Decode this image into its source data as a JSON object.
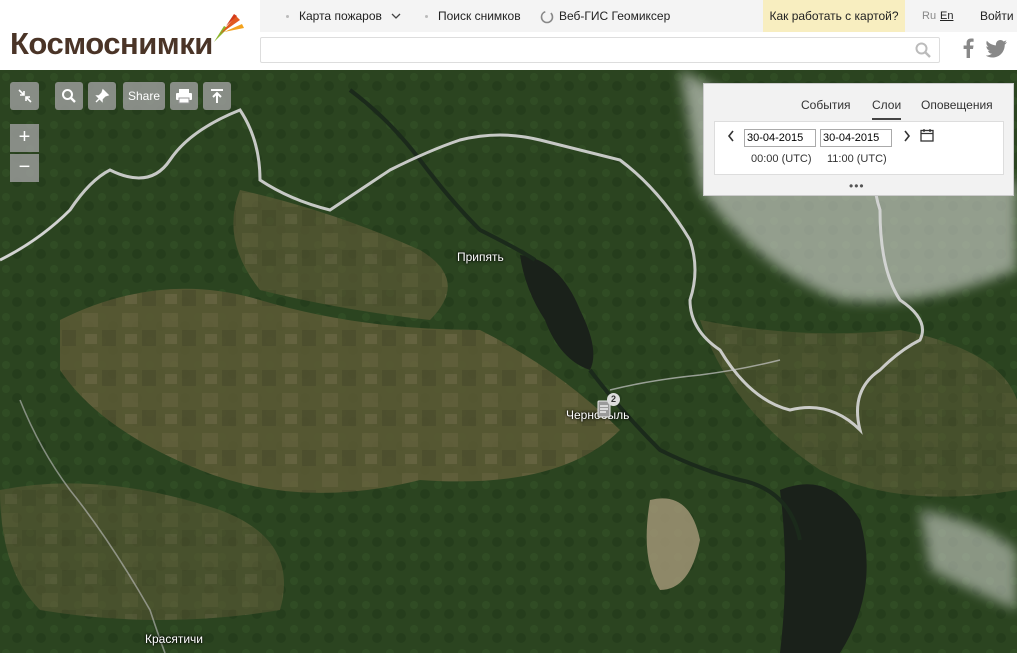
{
  "header": {
    "logo_text": "Космоснимки",
    "nav": [
      {
        "label": "Карта пожаров",
        "has_dropdown": true
      },
      {
        "label": "Поиск снимков"
      },
      {
        "label": "Веб-ГИС Геомиксер"
      }
    ],
    "help_label": "Как работать с картой?",
    "lang_ru": "Ru",
    "lang_en": "En",
    "login_label": "Войти",
    "search_value": "",
    "search_placeholder": ""
  },
  "toolbar": {
    "share_label": "Share",
    "zoom_in": "+",
    "zoom_out": "−"
  },
  "panel": {
    "tabs": [
      "События",
      "Слои",
      "Оповещения"
    ],
    "active_tab": "Слои",
    "date_from": "30-04-2015",
    "date_to": "30-04-2015",
    "time_from": "00:00 (UTC)",
    "time_to": "11:00 (UTC)",
    "more_label": "•••"
  },
  "map": {
    "labels": [
      "Припять",
      "Чернобыль",
      "Красятичи"
    ],
    "marker_count": "2",
    "colors": {
      "forest": "#2f4a22",
      "field": "#6e6640",
      "water": "#1b231b",
      "border": "#d8d8d8"
    }
  }
}
